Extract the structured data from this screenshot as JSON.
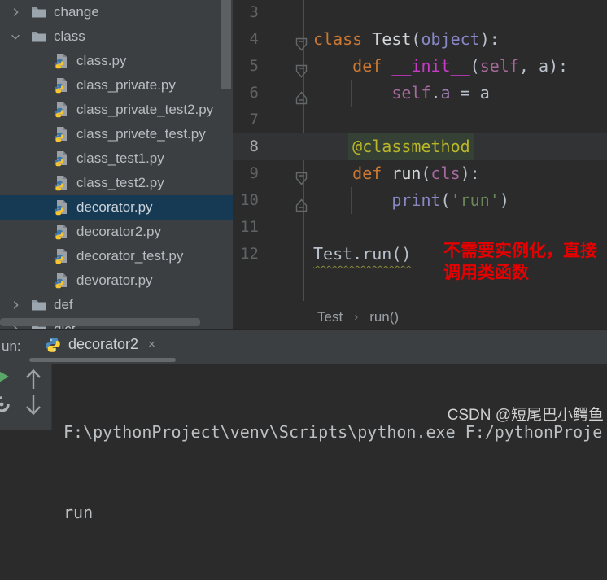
{
  "colors": {
    "panel_bg": "#3c3f41",
    "editor_bg": "#2b2b2b",
    "tree_selection": "#173a54",
    "keyword_orange": "#cc7832",
    "magic_method_magenta": "#c93ac9",
    "self_purple": "#a5699d",
    "builtin_blue": "#8888c6",
    "string_green": "#6a8759",
    "decorator_yellow": "#bbb529",
    "caret_highlight_green": "#344134",
    "annotation_red": "#e60000",
    "python_blue": "#4b8bbe",
    "python_yellow": "#ffd43b",
    "run_play_green": "#59a869"
  },
  "tree": {
    "items": [
      {
        "kind": "folder",
        "chevron": "right",
        "label": "change"
      },
      {
        "kind": "folder",
        "chevron": "down",
        "label": "class"
      },
      {
        "kind": "file",
        "label": "class.py"
      },
      {
        "kind": "file",
        "label": "class_private.py"
      },
      {
        "kind": "file",
        "label": "class_private_test2.py"
      },
      {
        "kind": "file",
        "label": "class_privete_test.py"
      },
      {
        "kind": "file",
        "label": "class_test1.py"
      },
      {
        "kind": "file",
        "label": "class_test2.py"
      },
      {
        "kind": "file",
        "label": "decorator.py",
        "selected": true
      },
      {
        "kind": "file",
        "label": "decorator2.py"
      },
      {
        "kind": "file",
        "label": "decorator_test.py"
      },
      {
        "kind": "file",
        "label": "devorator.py"
      },
      {
        "kind": "folder",
        "chevron": "right",
        "label": "def"
      },
      {
        "kind": "folder",
        "chevron": "right",
        "label": "dict"
      }
    ]
  },
  "editor": {
    "lines": [
      {
        "num": "3",
        "segs": []
      },
      {
        "num": "4",
        "fold": "down",
        "segs": [
          {
            "t": "class ",
            "c": "kw"
          },
          {
            "t": "Test",
            "c": "name"
          },
          {
            "t": "(",
            "c": "pl"
          },
          {
            "t": "object",
            "c": "builtin"
          },
          {
            "t": "):",
            "c": "pl"
          }
        ]
      },
      {
        "num": "5",
        "fold": "down",
        "segs": [
          {
            "t": "    ",
            "c": "pl"
          },
          {
            "t": "def ",
            "c": "kw"
          },
          {
            "t": "__init__",
            "c": "magic"
          },
          {
            "t": "(",
            "c": "pl"
          },
          {
            "t": "self",
            "c": "self"
          },
          {
            "t": ", a):",
            "c": "pl"
          }
        ]
      },
      {
        "num": "6",
        "fold": "up",
        "guide": true,
        "segs": [
          {
            "t": "        ",
            "c": "pl"
          },
          {
            "t": "self",
            "c": "self"
          },
          {
            "t": ".",
            "c": "pl"
          },
          {
            "t": "a",
            "c": "attr"
          },
          {
            "t": " = a",
            "c": "pl"
          }
        ]
      },
      {
        "num": "7",
        "segs": []
      },
      {
        "num": "8",
        "current": true,
        "segs": [
          {
            "t": "    ",
            "c": "pl"
          },
          {
            "t": "@classmethod",
            "c": "deco hl"
          }
        ]
      },
      {
        "num": "9",
        "fold": "down",
        "segs": [
          {
            "t": "    ",
            "c": "pl"
          },
          {
            "t": "def ",
            "c": "kw"
          },
          {
            "t": "run",
            "c": "name"
          },
          {
            "t": "(",
            "c": "pl"
          },
          {
            "t": "cls",
            "c": "self"
          },
          {
            "t": "):",
            "c": "pl"
          }
        ]
      },
      {
        "num": "10",
        "fold": "up",
        "guide": true,
        "segs": [
          {
            "t": "        ",
            "c": "pl"
          },
          {
            "t": "print",
            "c": "builtin"
          },
          {
            "t": "(",
            "c": "pl"
          },
          {
            "t": "'run'",
            "c": "str"
          },
          {
            "t": ")",
            "c": "pl"
          }
        ]
      },
      {
        "num": "11",
        "segs": []
      },
      {
        "num": "12",
        "segs": [
          {
            "t": "Test.run()",
            "c": "pl warn"
          }
        ]
      }
    ],
    "annotation": {
      "line1": "不需要实例化，直接",
      "line2": "调用类函数"
    },
    "breadcrumbs": {
      "crumb1": "Test",
      "separator": "›",
      "crumb2": "run()"
    }
  },
  "run_panel": {
    "run_label": "un:",
    "tab_label": "decorator2",
    "close_label": "×",
    "icons": [
      "python-logo-icon",
      "close-icon",
      "rerun-play-icon",
      "wrench-icon",
      "up-arrow-icon",
      "down-arrow-icon"
    ],
    "console": {
      "line1": "F:\\pythonProject\\venv\\Scripts\\python.exe F:/pythonProje",
      "line2": "run"
    },
    "watermark": "CSDN @短尾巴小鳄鱼"
  }
}
